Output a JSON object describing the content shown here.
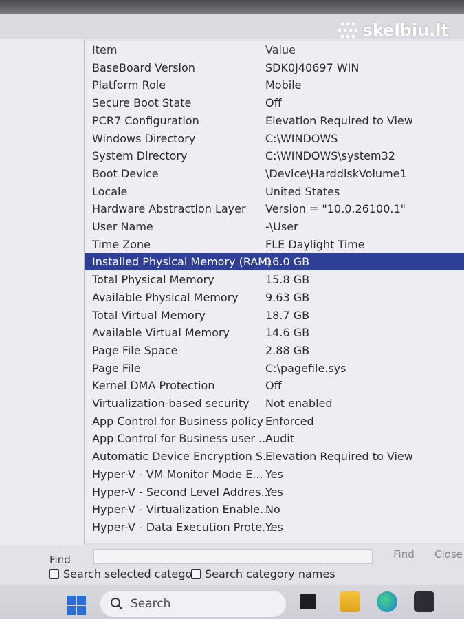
{
  "watermark": {
    "text": "skelbiu.lt"
  },
  "list": {
    "columns": {
      "item": "Item",
      "value": "Value"
    },
    "rows": [
      {
        "item": "BaseBoard Version",
        "value": "SDK0J40697 WIN"
      },
      {
        "item": "Platform Role",
        "value": "Mobile"
      },
      {
        "item": "Secure Boot State",
        "value": "Off"
      },
      {
        "item": "PCR7 Configuration",
        "value": "Elevation Required to View"
      },
      {
        "item": "Windows Directory",
        "value": "C:\\WINDOWS"
      },
      {
        "item": "System Directory",
        "value": "C:\\WINDOWS\\system32"
      },
      {
        "item": "Boot Device",
        "value": "\\Device\\HarddiskVolume1"
      },
      {
        "item": "Locale",
        "value": "United States"
      },
      {
        "item": "Hardware Abstraction Layer",
        "value": "Version = \"10.0.26100.1\""
      },
      {
        "item": "User Name",
        "value": "-\\User"
      },
      {
        "item": "Time Zone",
        "value": "FLE Daylight Time"
      },
      {
        "item": "Installed Physical Memory (RAM)",
        "value": "16.0 GB",
        "selected": true
      },
      {
        "item": "Total Physical Memory",
        "value": "15.8 GB"
      },
      {
        "item": "Available Physical Memory",
        "value": "9.63 GB"
      },
      {
        "item": "Total Virtual Memory",
        "value": "18.7 GB"
      },
      {
        "item": "Available Virtual Memory",
        "value": "14.6 GB"
      },
      {
        "item": "Page File Space",
        "value": "2.88 GB"
      },
      {
        "item": "Page File",
        "value": "C:\\pagefile.sys"
      },
      {
        "item": "Kernel DMA Protection",
        "value": "Off"
      },
      {
        "item": "Virtualization-based security",
        "value": "Not enabled"
      },
      {
        "item": "App Control for Business policy",
        "value": "Enforced"
      },
      {
        "item": "App Control for Business user ...",
        "value": "Audit"
      },
      {
        "item": "Automatic Device Encryption S...",
        "value": "Elevation Required to View"
      },
      {
        "item": "Hyper-V - VM Monitor Mode E...",
        "value": "Yes"
      },
      {
        "item": "Hyper-V - Second Level Addres...",
        "value": "Yes"
      },
      {
        "item": "Hyper-V - Virtualization Enable...",
        "value": "No"
      },
      {
        "item": "Hyper-V - Data Execution Prote...",
        "value": "Yes"
      }
    ]
  },
  "find": {
    "label": "Find",
    "find_button": "Find",
    "close_button": "Close",
    "option_selected_category": "Search selected categor",
    "option_category_names": "Search category names"
  },
  "taskbar": {
    "search_placeholder": "Search",
    "icons": [
      "windows-start-icon",
      "search-icon",
      "task-view-icon",
      "file-explorer-icon",
      "edge-browser-icon",
      "store-icon"
    ]
  },
  "colors": {
    "selection": "#2f3f95",
    "window_bg": "#eeedf1"
  }
}
